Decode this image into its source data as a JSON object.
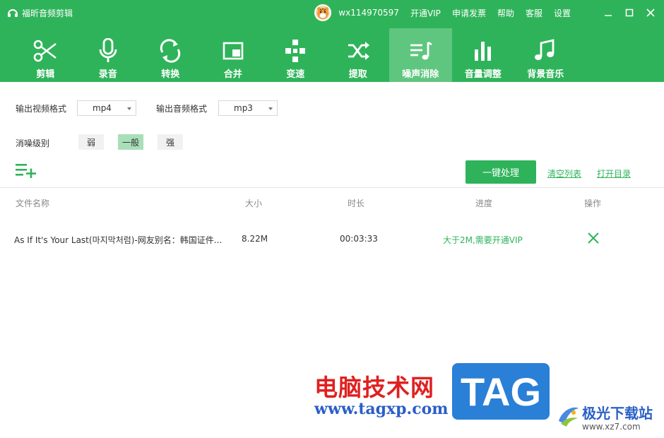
{
  "app": {
    "title": "福昕音频剪辑"
  },
  "top_bar": {
    "username": "wx114970597",
    "links": [
      "开通VIP",
      "申请发票",
      "帮助",
      "客服",
      "设置"
    ]
  },
  "nav": [
    {
      "label": "剪辑",
      "icon": "scissors-icon"
    },
    {
      "label": "录音",
      "icon": "microphone-icon"
    },
    {
      "label": "转换",
      "icon": "convert-icon"
    },
    {
      "label": "合并",
      "icon": "merge-icon"
    },
    {
      "label": "变速",
      "icon": "speed-icon"
    },
    {
      "label": "提取",
      "icon": "extract-icon"
    },
    {
      "label": "噪声消除",
      "icon": "noise-removal-icon",
      "active": true
    },
    {
      "label": "音量调整",
      "icon": "volume-bars-icon"
    },
    {
      "label": "背景音乐",
      "icon": "music-note-icon"
    }
  ],
  "options": {
    "video_format_label": "输出视频格式",
    "video_format_value": "mp4",
    "audio_format_label": "输出音频格式",
    "audio_format_value": "mp3",
    "level_label": "消噪级别",
    "levels": [
      "弱",
      "一般",
      "强"
    ],
    "selected_level": "一般"
  },
  "actions": {
    "process": "一键处理",
    "clear": "清空列表",
    "open_dir": "打开目录"
  },
  "table": {
    "headers": [
      "文件名称",
      "大小",
      "时长",
      "进度",
      "操作"
    ],
    "rows": [
      {
        "name": "As If It's Your Last(마지막처럼)-网友别名：韩国证件...",
        "size": "8.22M",
        "duration": "00:03:33",
        "progress": "大于2M,需要开通VIP"
      }
    ]
  },
  "watermark": {
    "cn": "电脑技术网",
    "url": "www.tagxp.com",
    "tag": "TAG",
    "site_name": "极光下载站",
    "site_url": "www.xz7.com"
  },
  "colors": {
    "brand": "#2fb35a",
    "active_tab": "#5fc67f",
    "selected_level": "#a9dfb8"
  }
}
